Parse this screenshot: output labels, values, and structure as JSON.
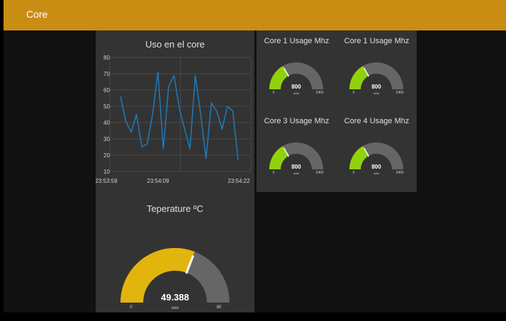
{
  "header": {
    "title": "Core"
  },
  "colors": {
    "header": "#c98d14",
    "card": "#333333",
    "line": "#1f77b4",
    "temp_fill": "#e2b50d",
    "core_fill": "#8fd20b",
    "gauge_track": "#666666"
  },
  "chart_card": {
    "title": "Uso en el core"
  },
  "chart_data": {
    "type": "line",
    "title": "Uso en el core",
    "x_ticks": [
      "23:53:59",
      "23:54:09",
      "23:54:22"
    ],
    "y_ticks": [
      "80",
      "70",
      "60",
      "50",
      "40",
      "30",
      "20",
      "10"
    ],
    "ylim": [
      10,
      80
    ],
    "series": [
      {
        "values": [
          56,
          41,
          34,
          45,
          25,
          27,
          45,
          71,
          24,
          62,
          69,
          49,
          36,
          24,
          69,
          45,
          18,
          52,
          47,
          36,
          50,
          47,
          17
        ]
      }
    ]
  },
  "temperature": {
    "title": "Teperature ºC",
    "value": 49.388,
    "value_label": "49.388",
    "units": "units",
    "min": 0,
    "max": 80,
    "min_label": "0",
    "max_label": "80",
    "fill_color": "#e2b50d"
  },
  "cores": [
    {
      "title": "Core 1 Usage Mhz",
      "value": 800,
      "value_label": "800",
      "units": "units",
      "min": 0,
      "max": 2400,
      "min_label": "0",
      "max_label": "2400"
    },
    {
      "title": "Core 1 Usage Mhz",
      "value": 800,
      "value_label": "800",
      "units": "units",
      "min": 0,
      "max": 2400,
      "min_label": "0",
      "max_label": "2400"
    },
    {
      "title": "Core 3 Usage Mhz",
      "value": 800,
      "value_label": "800",
      "units": "units",
      "min": 0,
      "max": 2400,
      "min_label": "0",
      "max_label": "2400"
    },
    {
      "title": "Core 4 Usage Mhz",
      "value": 800,
      "value_label": "800",
      "units": "units",
      "min": 0,
      "max": 2400,
      "min_label": "0",
      "max_label": "2400"
    }
  ]
}
